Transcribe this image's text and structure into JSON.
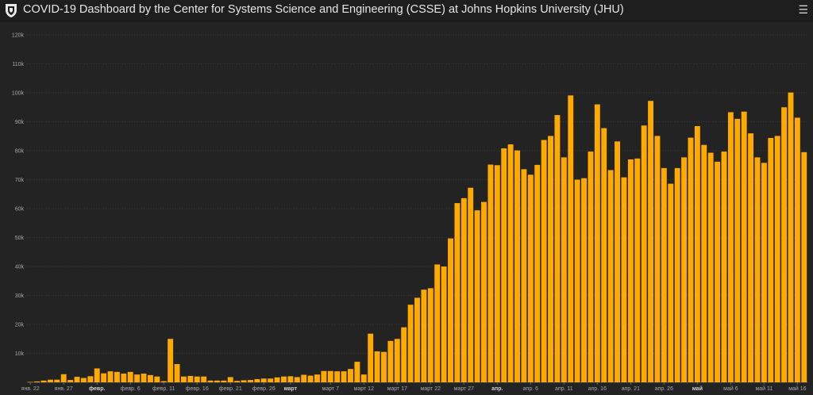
{
  "header": {
    "title": "COVID-19 Dashboard by the Center for Systems Science and Engineering (CSSE) at Johns Hopkins University (JHU)",
    "menu_icon": "hamburger-menu-icon",
    "logo_icon": "jhu-shield-icon"
  },
  "colors": {
    "bar": "#FFAA00",
    "background": "#232323",
    "grid": "#3a3a3a",
    "axis_text": "#a8a8a8"
  },
  "chart_data": {
    "type": "bar",
    "ylim": [
      0,
      120000
    ],
    "yticks": [
      {
        "value": 10000,
        "label": "10k"
      },
      {
        "value": 20000,
        "label": "20k"
      },
      {
        "value": 30000,
        "label": "30k"
      },
      {
        "value": 40000,
        "label": "40k"
      },
      {
        "value": 50000,
        "label": "50k"
      },
      {
        "value": 60000,
        "label": "60k"
      },
      {
        "value": 70000,
        "label": "70k"
      },
      {
        "value": 80000,
        "label": "80k"
      },
      {
        "value": 90000,
        "label": "90k"
      },
      {
        "value": 100000,
        "label": "100k"
      },
      {
        "value": 110000,
        "label": "110k"
      },
      {
        "value": 120000,
        "label": "120k"
      }
    ],
    "xticks": [
      {
        "index": 0,
        "label": "янв. 22",
        "bold": false
      },
      {
        "index": 5,
        "label": "янв. 27",
        "bold": false
      },
      {
        "index": 10,
        "label": "февр.",
        "bold": true
      },
      {
        "index": 15,
        "label": "февр. 6",
        "bold": false
      },
      {
        "index": 20,
        "label": "февр. 11",
        "bold": false
      },
      {
        "index": 25,
        "label": "февр. 16",
        "bold": false
      },
      {
        "index": 30,
        "label": "февр. 21",
        "bold": false
      },
      {
        "index": 35,
        "label": "февр. 26",
        "bold": false
      },
      {
        "index": 39,
        "label": "март",
        "bold": true
      },
      {
        "index": 45,
        "label": "март 7",
        "bold": false
      },
      {
        "index": 50,
        "label": "март 12",
        "bold": false
      },
      {
        "index": 55,
        "label": "март 17",
        "bold": false
      },
      {
        "index": 60,
        "label": "март 22",
        "bold": false
      },
      {
        "index": 65,
        "label": "март 27",
        "bold": false
      },
      {
        "index": 70,
        "label": "апр.",
        "bold": true
      },
      {
        "index": 75,
        "label": "апр. 6",
        "bold": false
      },
      {
        "index": 80,
        "label": "апр. 11",
        "bold": false
      },
      {
        "index": 85,
        "label": "апр. 16",
        "bold": false
      },
      {
        "index": 90,
        "label": "апр. 21",
        "bold": false
      },
      {
        "index": 95,
        "label": "апр. 26",
        "bold": false
      },
      {
        "index": 100,
        "label": "май",
        "bold": true
      },
      {
        "index": 105,
        "label": "май 6",
        "bold": false
      },
      {
        "index": 110,
        "label": "май 11",
        "bold": false
      },
      {
        "index": 115,
        "label": "май 16",
        "bold": false
      }
    ],
    "values": [
      100,
      300,
      600,
      900,
      900,
      2800,
      800,
      1900,
      1500,
      2100,
      4800,
      3100,
      3800,
      3600,
      3000,
      3600,
      2700,
      3000,
      2500,
      2000,
      400,
      15000,
      6300,
      2000,
      2200,
      2000,
      2000,
      600,
      600,
      600,
      1800,
      500,
      700,
      800,
      1100,
      1300,
      1300,
      1700,
      2000,
      2100,
      1800,
      2600,
      2300,
      2700,
      3900,
      3900,
      3800,
      3800,
      4600,
      7100,
      2700,
      16800,
      10700,
      10500,
      14300,
      15000,
      19000,
      26800,
      29200,
      32000,
      32500,
      40700,
      40000,
      49700,
      61900,
      63600,
      67200,
      59400,
      62300,
      75200,
      75000,
      80800,
      82200,
      80100,
      73600,
      71700,
      75100,
      83700,
      85100,
      92300,
      77700,
      99100,
      70000,
      70500,
      79700,
      96000,
      87800,
      73300,
      83200,
      70800,
      77000,
      77300,
      88700,
      97200,
      85100,
      74000,
      68600,
      74000,
      77700,
      84500,
      88500,
      82000,
      79300,
      76200,
      79700,
      93300,
      91000,
      93500,
      86000,
      77700,
      75800,
      84400,
      85100,
      95000,
      100100,
      91400,
      79500
    ]
  }
}
